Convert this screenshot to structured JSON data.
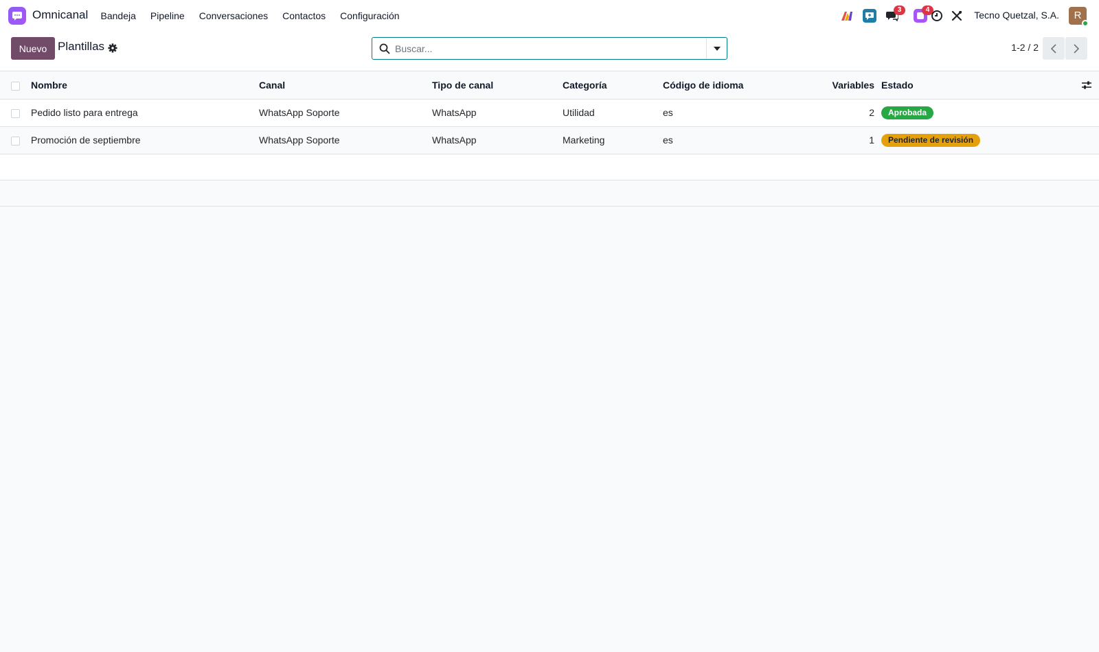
{
  "app": {
    "name": "Omnicanal",
    "menu": [
      "Bandeja",
      "Pipeline",
      "Conversaciones",
      "Contactos",
      "Configuración"
    ],
    "company": "Tecno Quetzal, S.A.",
    "avatar_initial": "R",
    "badges": {
      "messages": "3",
      "activities": "4"
    }
  },
  "control": {
    "new_label": "Nuevo",
    "title": "Plantillas",
    "search_placeholder": "Buscar...",
    "pager": "1-2 / 2"
  },
  "table": {
    "headers": [
      "Nombre",
      "Canal",
      "Tipo de canal",
      "Categoría",
      "Código de idioma",
      "Variables",
      "Estado"
    ],
    "rows": [
      {
        "nombre": "Pedido listo para entrega",
        "canal": "WhatsApp Soporte",
        "tipo": "WhatsApp",
        "categoria": "Utilidad",
        "idioma": "es",
        "variables": "2",
        "estado": "Aprobada",
        "estado_color": "#28a745"
      },
      {
        "nombre": "Promoción de septiembre",
        "canal": "WhatsApp Soporte",
        "tipo": "WhatsApp",
        "categoria": "Marketing",
        "idioma": "es",
        "variables": "1",
        "estado": "Pendiente de revisión",
        "estado_color": "#e5a00d"
      }
    ]
  },
  "colors": {
    "primary": "#714b67",
    "accent": "#017e84",
    "brand": "#8b5cf6"
  }
}
